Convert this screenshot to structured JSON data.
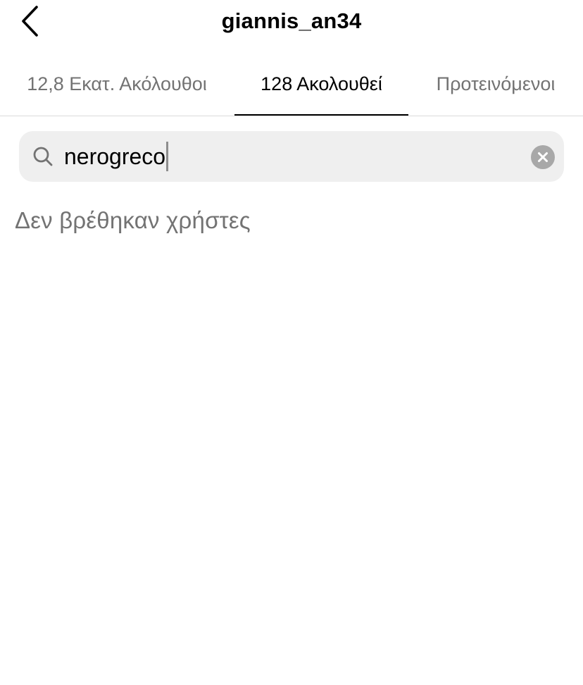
{
  "header": {
    "title": "giannis_an34",
    "back_icon": "chevron-left-icon"
  },
  "tabs": [
    {
      "label": "12,8 Εκατ. Ακόλουθοι",
      "active": false
    },
    {
      "label": "128 Ακολουθεί",
      "active": true
    },
    {
      "label": "Προτεινόμενοι",
      "active": false
    }
  ],
  "search": {
    "value": "nerogreco",
    "icon": "search-icon",
    "clear_icon": "clear-icon"
  },
  "results": {
    "empty_message": "Δεν βρέθηκαν χρήστες"
  },
  "colors": {
    "background": "#ffffff",
    "text_primary": "#000000",
    "text_secondary": "#737373",
    "search_bg": "#efefef",
    "divider": "#dbdbdb"
  }
}
